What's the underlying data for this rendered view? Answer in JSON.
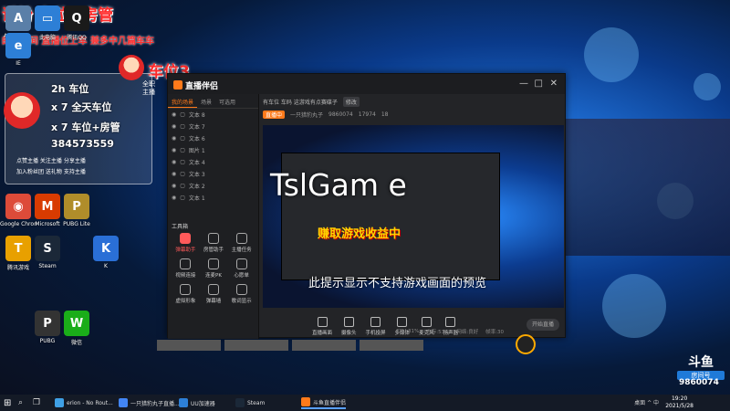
{
  "overlay": {
    "title": "话粉 车位+房管",
    "subtitle": "的直播间 直播位上车 兼多中几篇车车",
    "car_label": "车位3"
  },
  "sticker": {
    "lines": [
      "2h 车位",
      "x 7 全天车位",
      "x 7 车位+房管",
      "384573559"
    ],
    "small_lines": [
      "点赞主播 关注主播 分享主播",
      "加入粉丝团 送礼物 支持主播"
    ],
    "side_text": "全职主播"
  },
  "desktop": {
    "icons": [
      {
        "label": "Administ...",
        "glyph": "A",
        "color": "#5a7fa8"
      },
      {
        "label": "此电脑",
        "glyph": "▭",
        "color": "#2d7fd6"
      },
      {
        "label": "腾讯QQ",
        "glyph": "Q",
        "color": "#1a1a1a"
      },
      {
        "label": "IE",
        "glyph": "e",
        "color": "#2d7fd6"
      },
      {
        "label": "Google Chrome",
        "glyph": "◉",
        "color": "#dd4b39"
      },
      {
        "label": "Microsoft",
        "glyph": "M",
        "color": "#d83b01"
      },
      {
        "label": "PUBG Lite",
        "glyph": "P",
        "color": "#b08d2a"
      },
      {
        "label": "Steam",
        "glyph": "S",
        "color": "#1b2838"
      },
      {
        "label": "腾讯游戏",
        "glyph": "T",
        "color": "#e8a000"
      },
      {
        "label": "K",
        "glyph": "K",
        "color": "#2a6fd6"
      },
      {
        "label": "PUBG",
        "glyph": "P",
        "color": "#333"
      },
      {
        "label": "微信",
        "glyph": "W",
        "color": "#1aad19"
      }
    ]
  },
  "app": {
    "brand": "直播伴侣",
    "scene_tabs": [
      "我的场景",
      "场景",
      "可选用"
    ],
    "layers": [
      "文本 8",
      "文本 7",
      "文本 6",
      "图片 1",
      "文本 4",
      "文本 3",
      "文本 2",
      "文本 1"
    ],
    "tools_header": "工具箱",
    "tools": [
      {
        "label": "弹幕助手",
        "hot": true
      },
      {
        "label": "房管助手",
        "hot": false
      },
      {
        "label": "主播任务",
        "hot": false
      },
      {
        "label": "视频连接",
        "hot": false
      },
      {
        "label": "连麦PK",
        "hot": false
      },
      {
        "label": "心愿单",
        "hot": false
      },
      {
        "label": "虚拟形象",
        "hot": false
      },
      {
        "label": "弹幕墙",
        "hot": false
      },
      {
        "label": "歌词显示",
        "hot": false
      }
    ],
    "room_title": "有车位 车码 这游戏有点赛碟子",
    "room_tag": "修改",
    "stats": {
      "live": "直播中",
      "anchor": "一只猎豹丸子",
      "room_id": "9860074",
      "fans": "17974",
      "likes": "18"
    },
    "preview": {
      "big_text": "TslGam e",
      "red_text": "赚取游戏收益中",
      "hint": "此提示显示不支持游戏画面的预览"
    },
    "bottom_tools": [
      "直播画面",
      "摄像头",
      "手机投屏",
      "多媒体",
      "麦克风",
      "扬声器"
    ],
    "start_label": "开始直播",
    "status_items": [
      "CPU:31%",
      "内存:53%",
      "网络:良好",
      "帧率:30"
    ]
  },
  "right": {
    "logo": "斗鱼",
    "logo_sub": "房间号",
    "room_num": "9860074"
  },
  "taskbar": {
    "items": [
      {
        "label": "erion - No Rout...",
        "color": "#3fa0e6"
      },
      {
        "label": "一只猎豹丸子直播...",
        "color": "#4285f4"
      },
      {
        "label": "UU加速器",
        "color": "#2d7fd6"
      },
      {
        "label": "Steam",
        "color": "#1b2838"
      },
      {
        "label": "斗鱼直播伴侣",
        "color": "#ff7a1a"
      }
    ],
    "tray": "桌面 ^ 中",
    "time": "19:20",
    "date": "2021/5/28"
  }
}
